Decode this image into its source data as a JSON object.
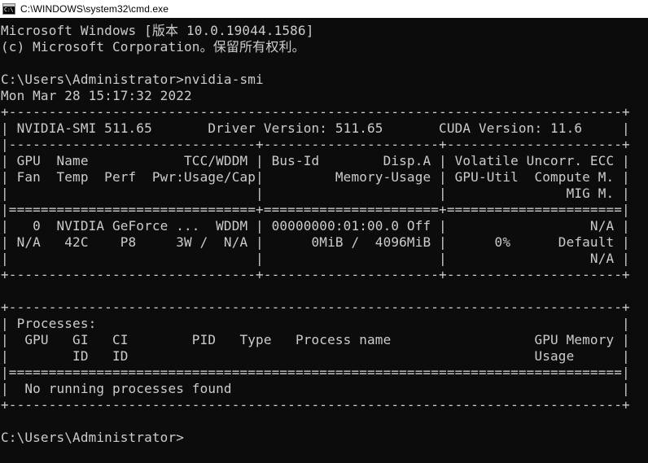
{
  "window": {
    "title": "C:\\WINDOWS\\system32\\cmd.exe",
    "icon": "cmd-console-icon",
    "icon_glyph": "C:\\",
    "background_color": "#0c0c0c",
    "foreground_color": "#cccccc",
    "titlebar_background": "#ffffff",
    "titlebar_foreground": "#000000"
  },
  "console": {
    "banner": [
      "Microsoft Windows [版本 10.0.19044.1586]",
      "(c) Microsoft Corporation。保留所有权利。"
    ],
    "prompt_line": {
      "prompt": "C:\\Users\\Administrator>",
      "command": "nvidia-smi"
    },
    "timestamp": "Mon Mar 28 15:17:32 2022",
    "final_prompt": "C:\\Users\\Administrator>",
    "nvidia_smi": {
      "header": {
        "smi_version_label": "NVIDIA-SMI",
        "smi_version": "511.65",
        "driver_version_label": "Driver Version:",
        "driver_version": "511.65",
        "cuda_version_label": "CUDA Version:",
        "cuda_version": "11.6"
      },
      "table_headers_row1": [
        "GPU",
        "Name",
        "TCC/WDDM",
        "Bus-Id",
        "Disp.A",
        "Volatile Uncorr. ECC"
      ],
      "table_headers_row2": [
        "Fan",
        "Temp",
        "Perf",
        "Pwr:Usage/Cap",
        "Memory-Usage",
        "GPU-Util",
        "Compute M."
      ],
      "table_headers_row3": [
        "MIG M."
      ],
      "gpus": [
        {
          "index": "0",
          "name": "NVIDIA GeForce ...",
          "driver_model": "WDDM",
          "bus_id": "00000000:01:00.0",
          "disp_a": "Off",
          "uncorr_ecc": "N/A",
          "fan": "N/A",
          "temp": "42C",
          "perf": "P8",
          "pwr_usage": "3W",
          "pwr_cap": "N/A",
          "memory_used": "0MiB",
          "memory_total": "4096MiB",
          "gpu_util": "0%",
          "compute_mode": "Default",
          "mig_mode": "N/A"
        }
      ],
      "processes": {
        "section_label": "Processes:",
        "headers_row1": [
          "GPU",
          "GI",
          "CI",
          "PID",
          "Type",
          "Process name",
          "GPU Memory"
        ],
        "headers_row2": [
          "ID",
          "ID",
          "Usage"
        ],
        "empty_message": "No running processes found",
        "rows": []
      }
    },
    "raw_lines": [
      "Microsoft Windows [版本 10.0.19044.1586]",
      "(c) Microsoft Corporation。保留所有权利。",
      "",
      "C:\\Users\\Administrator>nvidia-smi",
      "Mon Mar 28 15:17:32 2022",
      "+-----------------------------------------------------------------------------+",
      "| NVIDIA-SMI 511.65       Driver Version: 511.65       CUDA Version: 11.6     |",
      "|-------------------------------+----------------------+----------------------+",
      "| GPU  Name            TCC/WDDM | Bus-Id        Disp.A | Volatile Uncorr. ECC |",
      "| Fan  Temp  Perf  Pwr:Usage/Cap|         Memory-Usage | GPU-Util  Compute M. |",
      "|                               |                      |               MIG M. |",
      "|===============================+======================+======================|",
      "|   0  NVIDIA GeForce ...  WDDM | 00000000:01:00.0 Off |                  N/A |",
      "| N/A   42C    P8     3W /  N/A |      0MiB /  4096MiB |      0%      Default |",
      "|                               |                      |                  N/A |",
      "+-------------------------------+----------------------+----------------------+",
      "",
      "+-----------------------------------------------------------------------------+",
      "| Processes:                                                                  |",
      "|  GPU   GI   CI        PID   Type   Process name                  GPU Memory |",
      "|        ID   ID                                                   Usage      |",
      "|=============================================================================|",
      "|  No running processes found                                                 |",
      "+-----------------------------------------------------------------------------+",
      "",
      "C:\\Users\\Administrator>"
    ]
  }
}
